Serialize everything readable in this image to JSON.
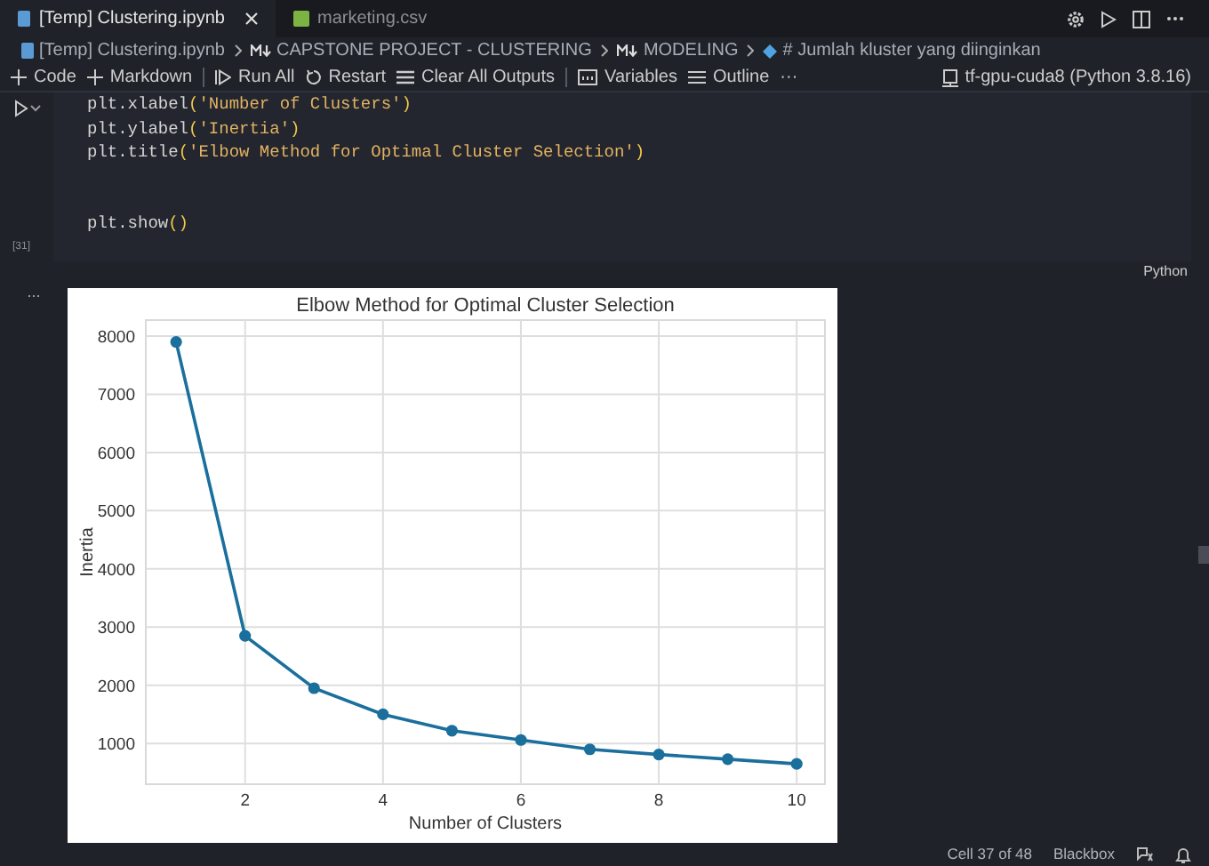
{
  "tabs": [
    {
      "label": "[Temp] Clustering.ipynb",
      "kind": "notebook",
      "selected": true,
      "closable": true
    },
    {
      "label": "marketing.csv",
      "kind": "csv",
      "selected": false,
      "closable": false
    }
  ],
  "breadcrumb": [
    {
      "label": "[Temp] Clustering.ipynb",
      "kind": "notebook"
    },
    {
      "label": "CAPSTONE PROJECT - CLUSTERING",
      "kind": "markdown"
    },
    {
      "label": "MODELING",
      "kind": "markdown"
    },
    {
      "label": "# Jumlah kluster yang diinginkan",
      "kind": "symbol"
    }
  ],
  "toolbar": [
    {
      "label": "Code",
      "kind": "plus"
    },
    {
      "label": "Markdown",
      "kind": "plus"
    },
    {
      "kind": "divider"
    },
    {
      "label": "Run All",
      "kind": "runall"
    },
    {
      "label": "Restart",
      "kind": "restart"
    },
    {
      "label": "Clear All Outputs",
      "kind": "clear"
    },
    {
      "kind": "divider"
    },
    {
      "label": "Variables",
      "kind": "variables"
    },
    {
      "label": "Outline",
      "kind": "outline"
    },
    {
      "label": "···",
      "kind": "more"
    }
  ],
  "kernel": "tf-gpu-cuda8 (Python 3.8.16)",
  "cell": {
    "execution_count": "[31]",
    "language": "Python",
    "code_blocks": [
      [
        [
          {
            "text": "plt.xlabel",
            "kind": "plain"
          },
          {
            "text": "(",
            "kind": "paren"
          },
          {
            "text": "'Number of Clusters'",
            "kind": "string"
          },
          {
            "text": ")",
            "kind": "paren"
          }
        ],
        [
          {
            "text": "plt.ylabel",
            "kind": "plain"
          },
          {
            "text": "(",
            "kind": "paren"
          },
          {
            "text": "'Inertia'",
            "kind": "string"
          },
          {
            "text": ")",
            "kind": "paren"
          }
        ],
        [
          {
            "text": "plt.title",
            "kind": "plain"
          },
          {
            "text": "(",
            "kind": "paren"
          },
          {
            "text": "'Elbow Method for Optimal Cluster Selection'",
            "kind": "string"
          },
          {
            "text": ")",
            "kind": "paren"
          }
        ]
      ],
      [
        [
          {
            "text": "plt.show",
            "kind": "plain"
          },
          {
            "text": "()",
            "kind": "paren"
          }
        ]
      ]
    ],
    "output_marker": "...",
    "chart_data": {
      "type": "line",
      "title": "Elbow Method for Optimal Cluster Selection",
      "xlabel": "Number of Clusters",
      "ylabel": "Inertia",
      "x": [
        1,
        2,
        3,
        4,
        5,
        6,
        7,
        8,
        9,
        10
      ],
      "grid": true,
      "series": [
        {
          "color": "#1a6f9c",
          "marker": "o",
          "values": [
            7900,
            2850,
            1950,
            1500,
            1220,
            1060,
            900,
            810,
            730,
            650
          ]
        }
      ],
      "xlim": [
        0.56,
        10.41
      ],
      "ylim": [
        300,
        8275
      ],
      "xticks": [
        2,
        4,
        6,
        8,
        10
      ],
      "yticks": [
        1000,
        2000,
        3000,
        4000,
        5000,
        6000,
        7000,
        8000
      ]
    }
  },
  "status_bar": {
    "cell_position": "Cell 37 of 48",
    "extension": "Blackbox"
  }
}
